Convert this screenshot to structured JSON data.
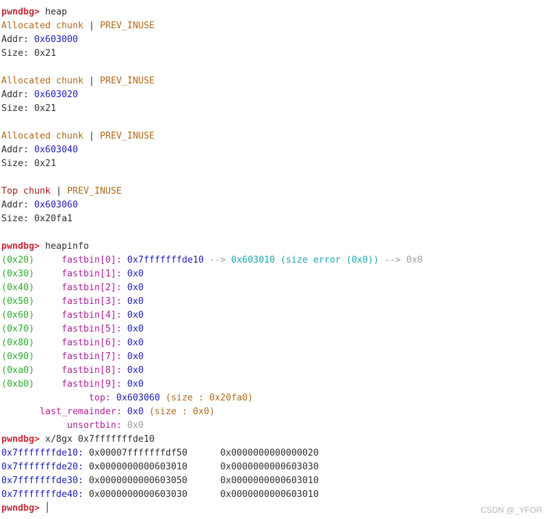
{
  "prompt": "pwndbg>",
  "cmd1": "heap",
  "chunks": [
    {
      "type": "Allocated chunk",
      "sep": "|",
      "flag": "PREV_INUSE",
      "addr_label": "Addr:",
      "addr": "0x603000",
      "size_label": "Size:",
      "size": "0x21"
    },
    {
      "type": "Allocated chunk",
      "sep": "|",
      "flag": "PREV_INUSE",
      "addr_label": "Addr:",
      "addr": "0x603020",
      "size_label": "Size:",
      "size": "0x21"
    },
    {
      "type": "Allocated chunk",
      "sep": "|",
      "flag": "PREV_INUSE",
      "addr_label": "Addr:",
      "addr": "0x603040",
      "size_label": "Size:",
      "size": "0x21"
    },
    {
      "type": "Top chunk",
      "sep": "|",
      "flag": "PREV_INUSE",
      "addr_label": "Addr:",
      "addr": "0x603060",
      "size_label": "Size:",
      "size": "0x20fa1"
    }
  ],
  "cmd2": "heapinfo",
  "fastbins": [
    {
      "size": "(0x20)",
      "name": "fastbin[0]:",
      "value": "0x7fffffffde10",
      "arrow1": "-->",
      "next": "0x603010",
      "err": "(size error (0x0))",
      "arrow2": "-->",
      "end": "0x0"
    },
    {
      "size": "(0x30)",
      "name": "fastbin[1]:",
      "value": "0x0"
    },
    {
      "size": "(0x40)",
      "name": "fastbin[2]:",
      "value": "0x0"
    },
    {
      "size": "(0x50)",
      "name": "fastbin[3]:",
      "value": "0x0"
    },
    {
      "size": "(0x60)",
      "name": "fastbin[4]:",
      "value": "0x0"
    },
    {
      "size": "(0x70)",
      "name": "fastbin[5]:",
      "value": "0x0"
    },
    {
      "size": "(0x80)",
      "name": "fastbin[6]:",
      "value": "0x0"
    },
    {
      "size": "(0x90)",
      "name": "fastbin[7]:",
      "value": "0x0"
    },
    {
      "size": "(0xa0)",
      "name": "fastbin[8]:",
      "value": "0x0"
    },
    {
      "size": "(0xb0)",
      "name": "fastbin[9]:",
      "value": "0x0"
    }
  ],
  "top": {
    "label": "top:",
    "value": "0x603060",
    "info": "(size : 0x20fa0)"
  },
  "last_remainder": {
    "label": "last_remainder:",
    "value": "0x0",
    "info": "(size : 0x0)"
  },
  "unsortbin": {
    "label": "unsortbin:",
    "value": "0x0"
  },
  "cmd3": "x/8gx 0x7fffffffde10",
  "memory": [
    {
      "addr": "0x7fffffffde10:",
      "v1": "0x00007fffffffdf50",
      "v2": "0x0000000000000020"
    },
    {
      "addr": "0x7fffffffde20:",
      "v1": "0x0000000000603010",
      "v2": "0x0000000000603030"
    },
    {
      "addr": "0x7fffffffde30:",
      "v1": "0x0000000000603050",
      "v2": "0x0000000000603010"
    },
    {
      "addr": "0x7fffffffde40:",
      "v1": "0x0000000000603030",
      "v2": "0x0000000000603010"
    }
  ],
  "watermark": "CSDN @_YFOR"
}
